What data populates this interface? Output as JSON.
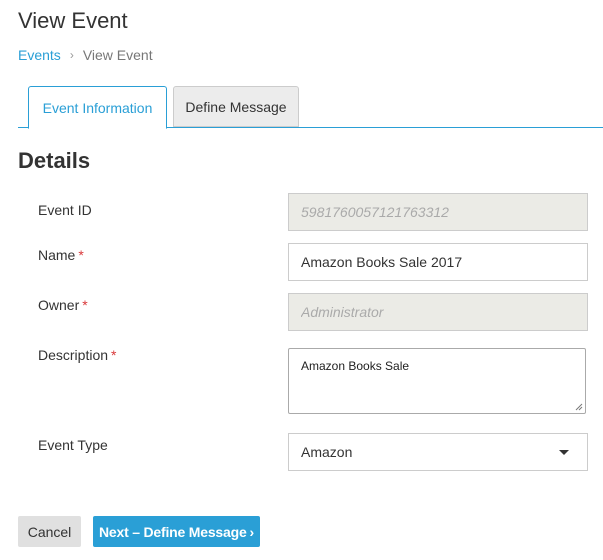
{
  "page": {
    "title": "View Event"
  },
  "breadcrumb": {
    "parent": "Events",
    "separator": "›",
    "current": "View Event"
  },
  "tabs": [
    {
      "label": "Event Information",
      "active": true
    },
    {
      "label": "Define Message",
      "active": false
    }
  ],
  "section": {
    "title": "Details"
  },
  "form": {
    "required_mark": "*",
    "event_id": {
      "label": "Event ID",
      "value": "5981760057121763312",
      "disabled": true
    },
    "name": {
      "label": "Name",
      "value": "Amazon Books Sale 2017",
      "required": true
    },
    "owner": {
      "label": "Owner",
      "value": "Administrator",
      "required": true,
      "disabled": true
    },
    "description": {
      "label": "Description",
      "value": "Amazon Books Sale",
      "required": true
    },
    "event_type": {
      "label": "Event Type",
      "value": "Amazon"
    }
  },
  "actions": {
    "cancel_label": "Cancel",
    "next_label": "Next – Define Message",
    "next_icon": "chevron-right-icon"
  },
  "colors": {
    "accent": "#2a9fd6",
    "required": "#d9383a",
    "disabled_bg": "#ebebe6"
  }
}
